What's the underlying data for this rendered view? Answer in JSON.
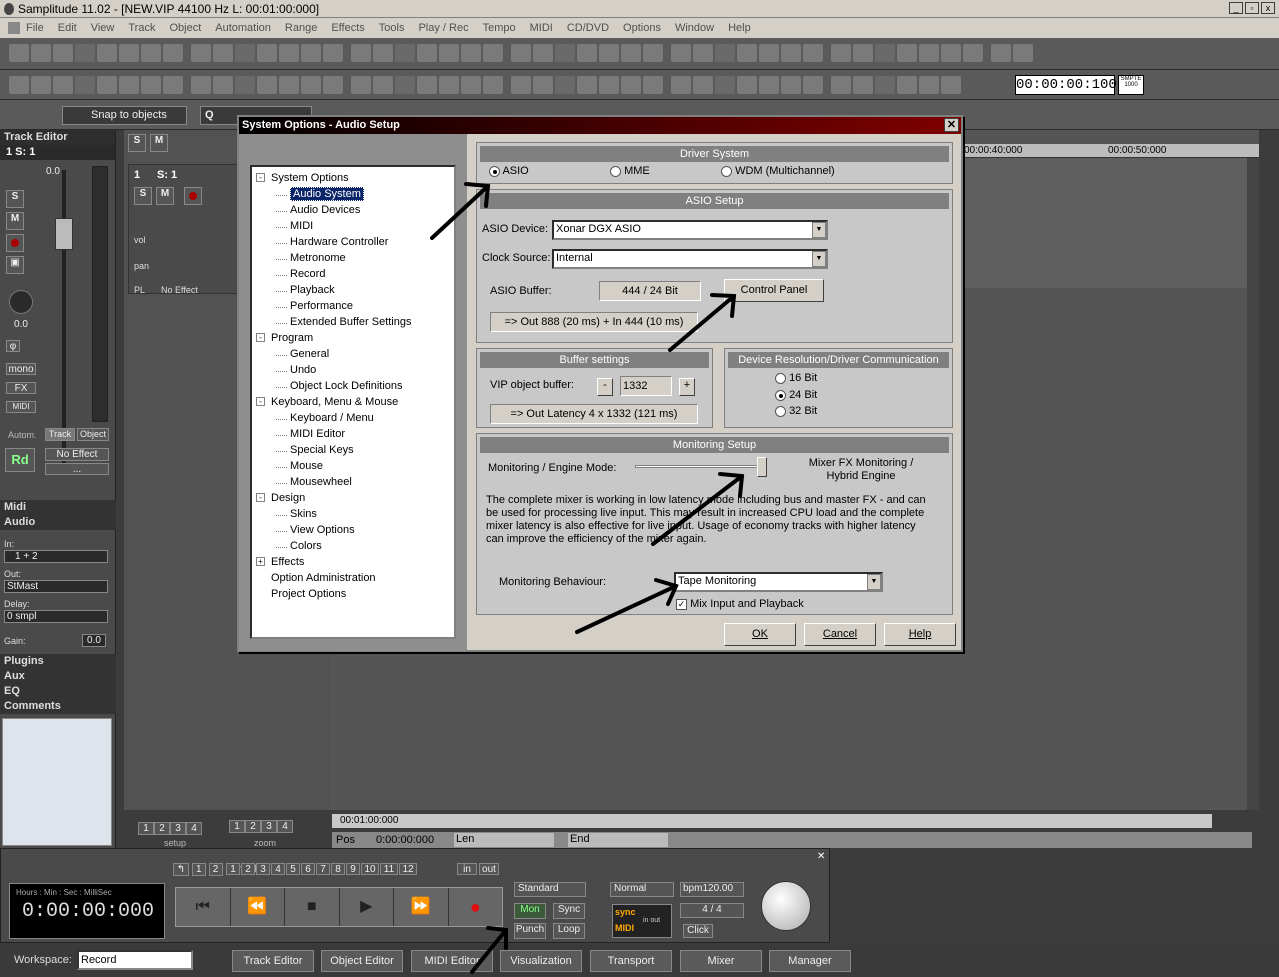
{
  "app": {
    "title": "Samplitude 11.02 - [NEW.VIP   44100 Hz L: 00:01:00:000]"
  },
  "menu": [
    "File",
    "Edit",
    "View",
    "Track",
    "Object",
    "Automation",
    "Range",
    "Effects",
    "Tools",
    "Play / Rec",
    "Tempo",
    "MIDI",
    "CD/DVD",
    "Options",
    "Window",
    "Help"
  ],
  "toolbar": {
    "time_display": "00:00:00:100",
    "smpte": "SMPTE 1000",
    "snap": "Snap to objects",
    "q": "Q"
  },
  "left": {
    "track_editor": "Track Editor",
    "track_sel": "1   S: 1",
    "vol_value": "0.0",
    "pan_value": "0.0",
    "mono": "mono",
    "fx": "FX",
    "midi": "MIDI",
    "autom": "Autom.",
    "track": "Track",
    "object": "Object",
    "rd": "Rd",
    "no_effect": "No Effect",
    "dots": "...",
    "midi_hdr": "Midi",
    "audio_hdr": "Audio",
    "in_label": "In:",
    "in_value": "1 + 2",
    "out_label": "Out:",
    "out_value": "StMast",
    "delay_label": "Delay:",
    "delay_value": "0 smpl",
    "gain_label": "Gain:",
    "gain_value": "0.0",
    "plugins": "Plugins",
    "aux": "Aux",
    "eq": "EQ",
    "comments": "Comments"
  },
  "track": {
    "s": "S",
    "m": "M",
    "num": "1",
    "name": "S: 1",
    "vol": "vol",
    "pan": "pan",
    "pl": "PL",
    "fx": "No Effect",
    "setup": "setup",
    "zoom": "zoom"
  },
  "ruler": {
    "t1": "00:00:40:000",
    "t2": "00:00:50:000",
    "bottom_time": "00:01:00:000",
    "pos_label": "Pos",
    "pos_value": "0:00:00:000",
    "len_label": "Len",
    "end_label": "End"
  },
  "dialog": {
    "title": "System Options - Audio Setup",
    "tree": [
      {
        "label": "System Options",
        "level": 0,
        "exp": "-"
      },
      {
        "label": "Audio System",
        "level": 1,
        "selected": true
      },
      {
        "label": "Audio Devices",
        "level": 1
      },
      {
        "label": "MIDI",
        "level": 1
      },
      {
        "label": "Hardware Controller",
        "level": 1
      },
      {
        "label": "Metronome",
        "level": 1
      },
      {
        "label": "Record",
        "level": 1
      },
      {
        "label": "Playback",
        "level": 1
      },
      {
        "label": "Performance",
        "level": 1
      },
      {
        "label": "Extended Buffer Settings",
        "level": 1
      },
      {
        "label": "Program",
        "level": 0,
        "exp": "-"
      },
      {
        "label": "General",
        "level": 1
      },
      {
        "label": "Undo",
        "level": 1
      },
      {
        "label": "Object Lock Definitions",
        "level": 1
      },
      {
        "label": "Keyboard, Menu & Mouse",
        "level": 0,
        "exp": "-"
      },
      {
        "label": "Keyboard / Menu",
        "level": 1
      },
      {
        "label": "MIDI Editor",
        "level": 1
      },
      {
        "label": "Special Keys",
        "level": 1
      },
      {
        "label": "Mouse",
        "level": 1
      },
      {
        "label": "Mousewheel",
        "level": 1
      },
      {
        "label": "Design",
        "level": 0,
        "exp": "-"
      },
      {
        "label": "Skins",
        "level": 1
      },
      {
        "label": "View Options",
        "level": 1
      },
      {
        "label": "Colors",
        "level": 1
      },
      {
        "label": "Effects",
        "level": 0,
        "exp": "+"
      },
      {
        "label": "Option Administration",
        "level": 0
      },
      {
        "label": "Project Options",
        "level": 0
      }
    ],
    "driver_system": "Driver System",
    "driver_options": [
      "ASIO",
      "MME",
      "WDM (Multichannel)"
    ],
    "asio_setup": "ASIO Setup",
    "asio_device_label": "ASIO Device:",
    "asio_device_value": "Xonar DGX ASIO",
    "clock_source_label": "Clock Source:",
    "clock_source_value": "Internal",
    "asio_buffer_label": "ASIO Buffer:",
    "asio_buffer_value": "444 / 24 Bit",
    "control_panel": "Control Panel",
    "asio_latency": "=> Out 888 (20 ms) + In 444 (10 ms)",
    "buffer_settings": "Buffer settings",
    "vip_buffer_label": "VIP object buffer:",
    "vip_buffer_value": "1332",
    "minus": "-",
    "plus": "+",
    "buffer_latency": "=> Out Latency 4 x 1332 (121 ms)",
    "device_resolution": "Device Resolution/Driver Communication",
    "bits": [
      "16 Bit",
      "24 Bit",
      "32 Bit"
    ],
    "monitoring_setup": "Monitoring Setup",
    "engine_mode_label": "Monitoring / Engine Mode:",
    "engine_mode_value": "Mixer FX Monitoring / Hybrid Engine",
    "description": "The complete mixer is working in low latency mode including bus and master FX - and can be used for processing live input.  This may result in increased CPU load and the complete mixer latency is also effective for live input. Usage of economy tracks with higher latency can improve the efficiency of the mixer again.",
    "behaviour_label": "Monitoring Behaviour:",
    "behaviour_value": "Tape Monitoring",
    "mix_input": "Mix Input and Playback",
    "ok": "OK",
    "cancel": "Cancel",
    "help": "Help"
  },
  "transport": {
    "counter_label": "Hours : Min : Sec : MilliSec",
    "counter": "0:00:00:000",
    "marker": "marker",
    "nums": [
      "1",
      "2"
    ],
    "marker_nums": [
      "1",
      "2",
      "3",
      "4",
      "5",
      "6",
      "7",
      "8",
      "9",
      "10",
      "11",
      "12"
    ],
    "in": "in",
    "out": "out",
    "standard": "Standard",
    "mon": "Mon",
    "sync": "Sync",
    "punch": "Punch",
    "loop": "Loop",
    "normal": "Normal",
    "bpm": "bpm120.00",
    "sig": "4 / 4",
    "click": "Click",
    "sync_label": "sync",
    "midi_label": "MIDI",
    "in_out": "in out"
  },
  "tabs": {
    "workspace_label": "Workspace:",
    "workspace_value": "Record",
    "items": [
      "Track Editor",
      "Object Editor",
      "MIDI Editor",
      "Visualization",
      "Transport",
      "Mixer",
      "Manager"
    ]
  },
  "colors": {
    "accent_title": "#800000",
    "selected": "#0a246a",
    "record": "#e01010"
  }
}
